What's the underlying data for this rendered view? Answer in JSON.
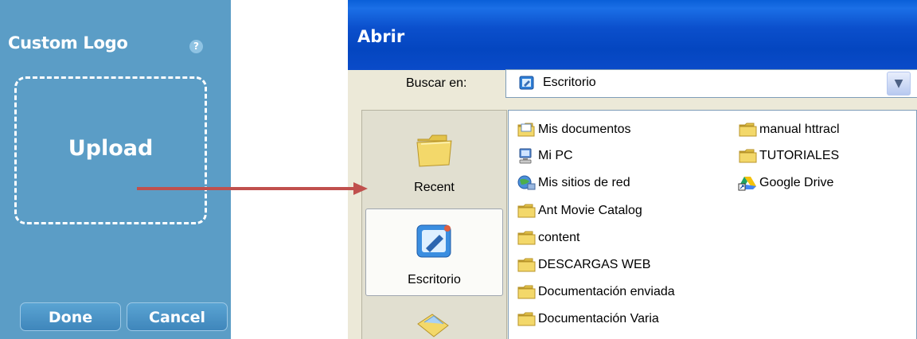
{
  "panel": {
    "title": "Custom Logo",
    "help_icon": "?",
    "upload_label": "Upload",
    "done_label": "Done",
    "cancel_label": "Cancel",
    "bg_color": "#5b9dc6"
  },
  "arrow": {
    "color": "#c0504d"
  },
  "dialog": {
    "title": "Abrir",
    "look_in_label": "Buscar en:",
    "look_in_value": "Escritorio",
    "places": [
      {
        "label": "Recent",
        "icon": "folder-icon"
      },
      {
        "label": "Escritorio",
        "icon": "desktop-icon"
      }
    ],
    "files_col1": [
      {
        "name": "Mis documentos",
        "icon": "documents-icon"
      },
      {
        "name": "Mi PC",
        "icon": "computer-icon"
      },
      {
        "name": "Mis sitios de red",
        "icon": "network-icon"
      },
      {
        "name": "Ant Movie Catalog",
        "icon": "folder-icon"
      },
      {
        "name": "content",
        "icon": "folder-icon"
      },
      {
        "name": "DESCARGAS WEB",
        "icon": "folder-icon"
      },
      {
        "name": "Documentación enviada",
        "icon": "folder-icon"
      },
      {
        "name": "Documentación Varia",
        "icon": "folder-icon"
      }
    ],
    "files_col2": [
      {
        "name": "manual httracl",
        "icon": "folder-icon"
      },
      {
        "name": "TUTORIALES",
        "icon": "folder-icon"
      },
      {
        "name": "Google Drive",
        "icon": "google-drive-shortcut-icon"
      }
    ]
  }
}
